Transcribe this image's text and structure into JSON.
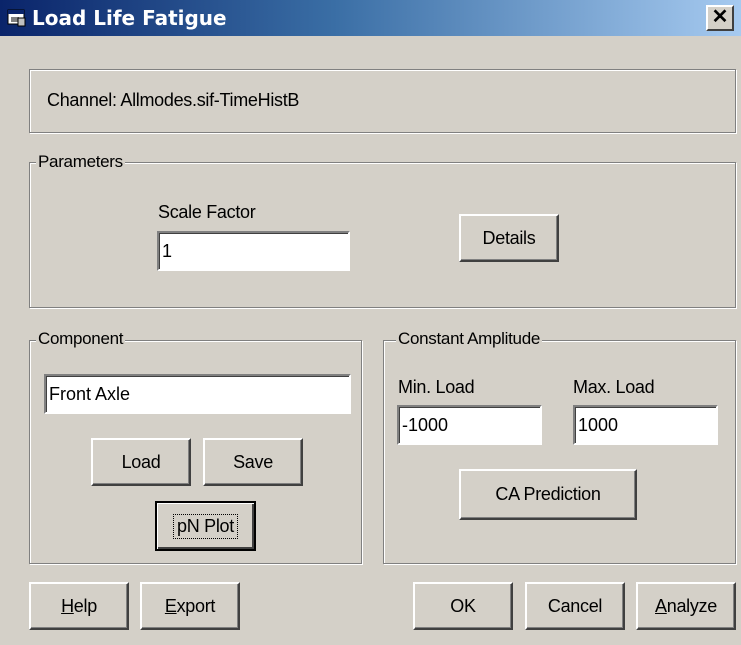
{
  "window": {
    "title": "Load Life Fatigue",
    "close_glyph": "✕"
  },
  "channel": {
    "text": "Channel: Allmodes.sif-TimeHistB"
  },
  "parameters": {
    "legend": "Parameters",
    "scale_factor_label": "Scale Factor",
    "scale_factor_value": "1",
    "details_label": "Details"
  },
  "component": {
    "legend": "Component",
    "name_value": "Front Axle",
    "load_label": "Load",
    "save_label": "Save",
    "pn_plot_label": "pN Plot"
  },
  "constant_amplitude": {
    "legend": "Constant Amplitude",
    "min_load_label": "Min. Load",
    "min_load_value": "-1000",
    "max_load_label": "Max. Load",
    "max_load_value": "1000",
    "ca_prediction_label": "CA Prediction"
  },
  "bottom": {
    "help_first": "H",
    "help_rest": "elp",
    "export_first": "E",
    "export_rest": "xport",
    "ok_label": "OK",
    "cancel_label": "Cancel",
    "analyze_first": "A",
    "analyze_rest": "nalyze"
  },
  "icons": {
    "title": "app-window-icon",
    "close": "close-icon"
  }
}
